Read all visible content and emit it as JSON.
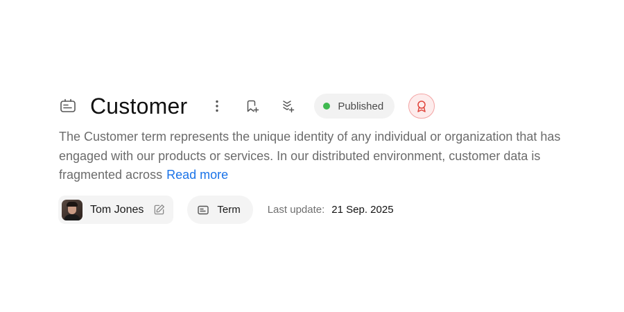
{
  "term": {
    "title": "Customer",
    "type_icon": "term-icon"
  },
  "toolbar": {
    "more_icon": "more-vertical-icon",
    "bookmark_icon": "bookmark-add-icon",
    "collection_icon": "collection-add-icon"
  },
  "status": {
    "label": "Published",
    "color": "#3fb950"
  },
  "certification": {
    "icon": "award-icon",
    "color": "#e0433a"
  },
  "description": {
    "text": "The Customer term represents the unique identity of any individual or organization that has engaged with our products or services. In our distributed environment, customer data is fragmented across",
    "read_more": "Read more"
  },
  "meta": {
    "owner_name": "Tom Jones",
    "type_label": "Term",
    "last_update_label": "Last update:",
    "last_update_value": "21 Sep. 2025"
  },
  "colors": {
    "link": "#1a73e8",
    "chip_bg": "#f4f4f4"
  }
}
